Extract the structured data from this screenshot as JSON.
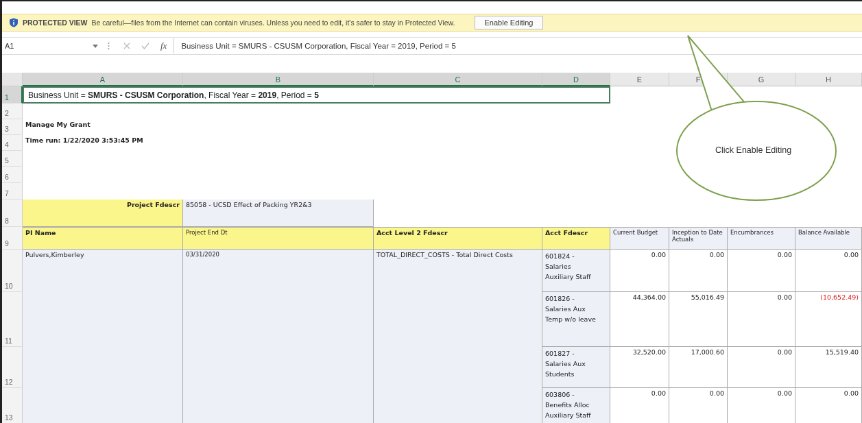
{
  "protected_view": {
    "label": "PROTECTED VIEW",
    "message": "Be careful—files from the Internet can contain viruses. Unless you need to edit, it's safer to stay in Protected View.",
    "button": "Enable Editing"
  },
  "formula_bar": {
    "name_box": "A1",
    "function_symbol": "fx",
    "formula": "Business Unit = SMURS - CSUSM Corporation, Fiscal Year = 2019, Period = 5"
  },
  "columns": [
    {
      "label": "A",
      "selected": true
    },
    {
      "label": "B",
      "selected": true
    },
    {
      "label": "C",
      "selected": true
    },
    {
      "label": "D",
      "selected": true
    },
    {
      "label": "E",
      "selected": false
    },
    {
      "label": "F",
      "selected": false
    },
    {
      "label": "G",
      "selected": false
    },
    {
      "label": "H",
      "selected": false
    }
  ],
  "rows": [
    {
      "label": "1",
      "selected": true
    },
    {
      "label": "2",
      "selected": false
    },
    {
      "label": "3",
      "selected": false
    },
    {
      "label": "4",
      "selected": false
    },
    {
      "label": "5",
      "selected": false
    },
    {
      "label": "6",
      "selected": false
    },
    {
      "label": "7",
      "selected": false
    },
    {
      "label": "8",
      "selected": false
    },
    {
      "label": "9",
      "selected": false
    },
    {
      "label": "10",
      "selected": false
    },
    {
      "label": "11",
      "selected": false
    },
    {
      "label": "12",
      "selected": false
    },
    {
      "label": "13",
      "selected": false
    }
  ],
  "report_header": "Business Unit = **SMURS - CSUSM Corporation**, Fiscal Year = **2019**, Period = **5**",
  "report_title": "Manage My Grant",
  "time_run": "Time run: 1/22/2020 3:53:45 PM",
  "project_filter": {
    "label": "Project Fdescr",
    "value": "85058 - UCSD Effect of Packing YR2&3"
  },
  "table_headers": [
    {
      "label": "PI Name",
      "bold": true
    },
    {
      "label": "Project End Dt",
      "bold": false
    },
    {
      "label": "Acct Level 2 Fdescr",
      "bold": true
    },
    {
      "label": "Acct Fdescr",
      "bold": true
    },
    {
      "label": "Current Budget",
      "bold": false
    },
    {
      "label": "Inception to Date Actuals",
      "bold": false
    },
    {
      "label": "Encumbrances",
      "bold": false
    },
    {
      "label": "Balance Available",
      "bold": false
    }
  ],
  "project": {
    "pi_name": "Pulvers,Kimberley",
    "project_end_dt": "03/31/2020",
    "acct_level_2": "TOTAL_DIRECT_COSTS - Total Direct Costs",
    "accounts": [
      {
        "acct": "601824 - Salaries Auxiliary Staff",
        "current_budget": "0.00",
        "inception_to_date": "0.00",
        "encumbrances": "0.00",
        "balance": "0.00",
        "negative": false
      },
      {
        "acct": "601826 - Salaries Aux Temp w/o leave",
        "current_budget": "44,364.00",
        "inception_to_date": "55,016.49",
        "encumbrances": "0.00",
        "balance": "(10,652.49)",
        "negative": true
      },
      {
        "acct": "601827 - Salaries Aux Students",
        "current_budget": "32,520.00",
        "inception_to_date": "17,000.60",
        "encumbrances": "0.00",
        "balance": "15,519.40",
        "negative": false
      },
      {
        "acct": "603806 - Benefits Alloc Auxiliary Staff",
        "current_budget": "0.00",
        "inception_to_date": "0.00",
        "encumbrances": "0.00",
        "balance": "0.00",
        "negative": false
      }
    ]
  },
  "callout": {
    "text": "Click Enable Editing"
  }
}
